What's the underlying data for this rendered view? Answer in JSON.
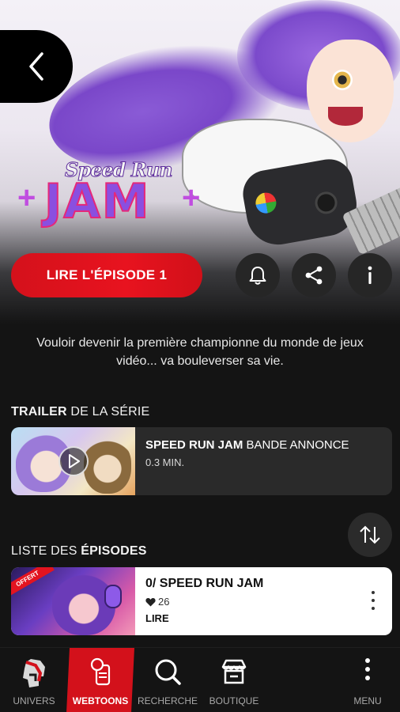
{
  "hero": {
    "logo_top": "Speed Run",
    "logo_main": "JAM",
    "logo_plus_left": "+",
    "logo_plus_right": "+"
  },
  "actions": {
    "read_label": "LIRE L'ÉPISODE 1"
  },
  "description": "Vouloir devenir la première championne du monde de jeux vidéo... va bouleverser sa vie.",
  "trailer_section": {
    "title_bold": "TRAILER",
    "title_rest": " DE LA SÉRIE",
    "item": {
      "name_bold": "SPEED RUN JAM",
      "name_rest": " BANDE ANNONCE",
      "duration": "0.3 MIN."
    }
  },
  "episodes_section": {
    "title_rest": "LISTE DES ",
    "title_bold": "ÉPISODES",
    "items": [
      {
        "badge": "OFFERT",
        "title": "0/ SPEED RUN JAM",
        "likes": "26",
        "action": "LIRE"
      }
    ]
  },
  "nav": {
    "items": [
      {
        "label": "UNIVERS"
      },
      {
        "label": "WEBTOONS"
      },
      {
        "label": "RECHERCHE"
      },
      {
        "label": "BOUTIQUE"
      },
      {
        "label": "MENU"
      }
    ],
    "active": "WEBTOONS",
    "accent": "#d3111b"
  },
  "colors": {
    "background": "#141414",
    "primary_red": "#e8131f",
    "card": "#2a2a2a"
  }
}
